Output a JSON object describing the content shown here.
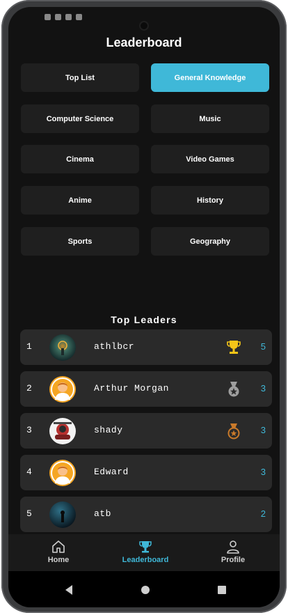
{
  "header": {
    "title": "Leaderboard"
  },
  "categories": [
    {
      "label": "Top List",
      "active": false
    },
    {
      "label": "General Knowledge",
      "active": true
    },
    {
      "label": "Computer Science",
      "active": false
    },
    {
      "label": "Music",
      "active": false
    },
    {
      "label": "Cinema",
      "active": false
    },
    {
      "label": "Video Games",
      "active": false
    },
    {
      "label": "Anime",
      "active": false
    },
    {
      "label": "History",
      "active": false
    },
    {
      "label": "Sports",
      "active": false
    },
    {
      "label": "Geography",
      "active": false
    }
  ],
  "top_leaders": {
    "title": "Top Leaders",
    "rows": [
      {
        "rank": "1",
        "name": "athlbcr",
        "score": "5",
        "medal": "trophy-icon"
      },
      {
        "rank": "2",
        "name": "Arthur Morgan",
        "score": "3",
        "medal": "silver-medal-icon"
      },
      {
        "rank": "3",
        "name": "shady",
        "score": "3",
        "medal": "bronze-medal-icon"
      },
      {
        "rank": "4",
        "name": "Edward",
        "score": "3",
        "medal": ""
      },
      {
        "rank": "5",
        "name": "atb",
        "score": "2",
        "medal": ""
      }
    ]
  },
  "nav": {
    "home": "Home",
    "leaderboard": "Leaderboard",
    "profile": "Profile"
  },
  "colors": {
    "accent": "#3fb8d8",
    "background": "#121212",
    "card": "#2a2a2a",
    "gold": "#f5c518",
    "silver": "#9e9e9e",
    "bronze": "#c97a2a"
  }
}
